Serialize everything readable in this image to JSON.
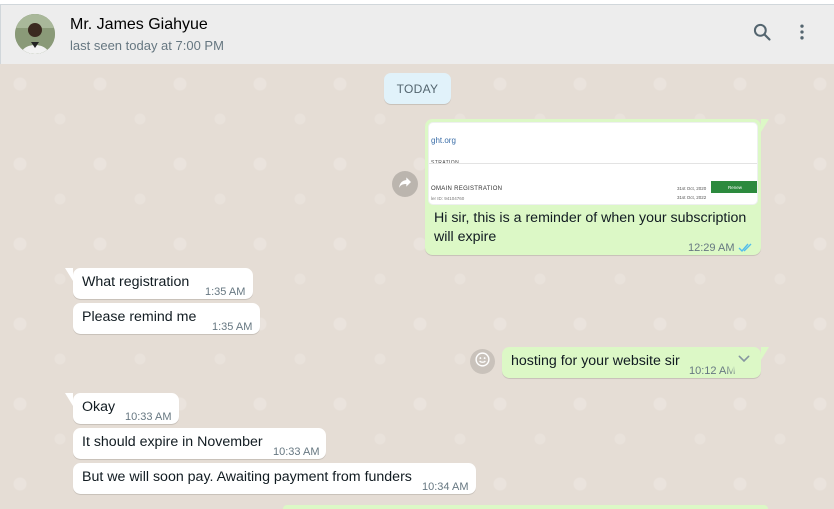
{
  "header": {
    "contact_name": "Mr. James Giahyue",
    "status": "last seen today at 7:00 PM",
    "icons": [
      "search-icon",
      "more-vertical-icon"
    ]
  },
  "chat": {
    "date_label": "TODAY",
    "messages": [
      {
        "direction": "outgoing",
        "has_image": true,
        "image": {
          "site": "ght.org",
          "section": "STRATION",
          "heading": "OMAIN REGISTRATION",
          "order_id": "ler ID: 94104760",
          "date1": "31st Oct, 2020",
          "date2": "31st Oct, 2022",
          "button": "Renew"
        },
        "text": "Hi sir, this is a reminder of when your subscription will expire",
        "time": "12:29 AM",
        "status": "read"
      },
      {
        "direction": "incoming",
        "text": "What registration",
        "time": "1:35 AM"
      },
      {
        "direction": "incoming",
        "text": "Please remind me",
        "time": "1:35 AM"
      },
      {
        "direction": "outgoing",
        "text": "hosting for your website sir",
        "time": "10:12 AM",
        "status": "delivered"
      },
      {
        "direction": "incoming",
        "text": "Okay",
        "time": "10:33 AM"
      },
      {
        "direction": "incoming",
        "text": "It should expire in November",
        "time": "10:33 AM"
      },
      {
        "direction": "incoming",
        "text": "But we will soon pay. Awaiting payment from funders",
        "time": "10:34 AM"
      }
    ]
  },
  "colors": {
    "outgoing_bubble": "#dcf8c6",
    "incoming_bubble": "#ffffff",
    "chat_background": "#e5ddd5",
    "header_background": "#ededed",
    "read_tick": "#53bdeb"
  }
}
